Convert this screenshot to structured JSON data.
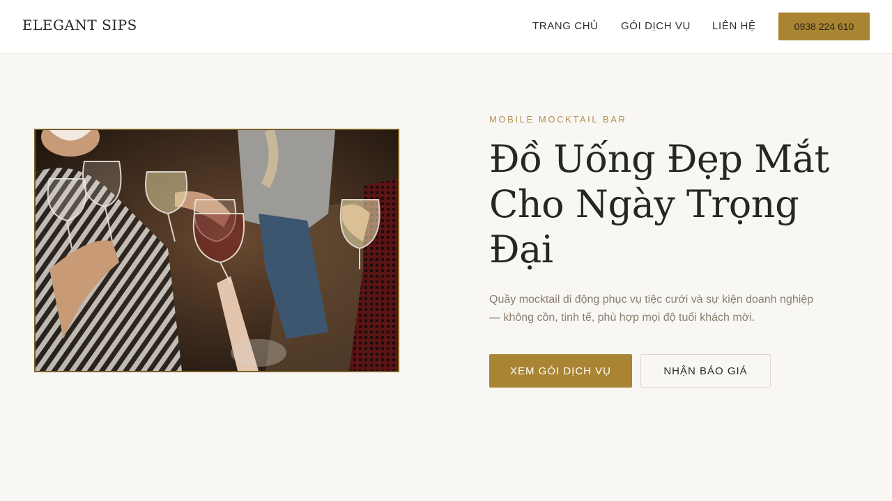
{
  "header": {
    "brand": "ELEGANT SIPS",
    "nav": [
      {
        "label": "TRANG CHỦ"
      },
      {
        "label": "GÓI DỊCH VỤ"
      },
      {
        "label": "LIÊN HỆ"
      }
    ],
    "phone_button": "0938 224 610"
  },
  "hero": {
    "eyebrow": "MOBILE MOCKTAIL BAR",
    "headline": "Đồ Uống Đẹp Mắt Cho Ngày Trọng Đại",
    "description": "Quầy mocktail di động phục vụ tiệc cưới và sự kiện doanh nghiệp — không cồn, tinh tế, phù hợp mọi độ tuổi khách mời.",
    "primary_button": "XEM GÓI DỊCH VỤ",
    "secondary_button": "NHẬN BÁO GIÁ"
  },
  "colors": {
    "accent": "#a98432",
    "page_background": "#f8f7f3",
    "header_background": "#ffffff",
    "heading_text": "#262624",
    "eyebrow_text": "#b08f52",
    "body_text": "#8a7d70"
  }
}
